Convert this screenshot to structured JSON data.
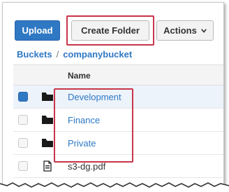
{
  "toolbar": {
    "upload_label": "Upload",
    "create_folder_label": "Create Folder",
    "actions_label": "Actions",
    "actions_caret": "v"
  },
  "breadcrumb": {
    "root": "Buckets",
    "separator": "/",
    "bucket": "companybucket"
  },
  "table": {
    "column_name": "Name",
    "rows": [
      {
        "name": "Development",
        "type": "folder",
        "selected": true
      },
      {
        "name": "Finance",
        "type": "folder",
        "selected": false
      },
      {
        "name": "Private",
        "type": "folder",
        "selected": false
      },
      {
        "name": "s3-dg.pdf",
        "type": "file",
        "selected": false
      }
    ]
  },
  "colors": {
    "primary": "#2f78c4",
    "highlight": "#c8354a",
    "selected_row": "#edf3fa"
  }
}
